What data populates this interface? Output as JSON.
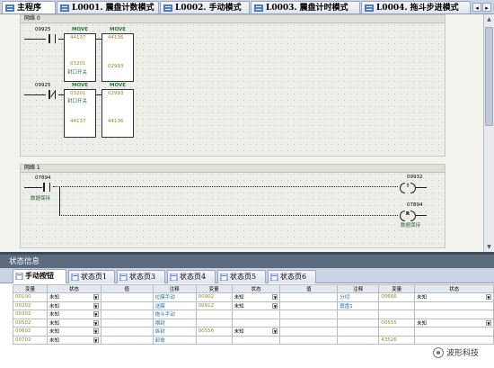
{
  "tabs": [
    {
      "label": "主程序",
      "active": true
    },
    {
      "label": "L0001. 震盘计数模式",
      "active": false
    },
    {
      "label": "L0002. 手动模式",
      "active": false
    },
    {
      "label": "L0003. 震盘计时模式",
      "active": false
    },
    {
      "label": "L0004. 拖斗步进模式",
      "active": false
    }
  ],
  "network0": {
    "title": "网络 0",
    "rung1": {
      "contact": "09925",
      "move1": {
        "title": "MOVE",
        "in": "44137",
        "out": "03201",
        "note": "封口开关"
      },
      "move2": {
        "title": "MOVE",
        "in": "44136",
        "out": "02993"
      }
    },
    "rung2": {
      "contact": "09925",
      "move1": {
        "title": "MOVE",
        "in": "03201",
        "note": "封口开关",
        "out": "44137"
      },
      "move2": {
        "title": "MOVE",
        "in": "02993",
        "out": "44136"
      }
    }
  },
  "network1": {
    "title": "网络 1",
    "contact": "07894",
    "contact_note": "数据保持",
    "coil1": {
      "addr": "09932",
      "symbol": "↑"
    },
    "coil2": {
      "addr": "07894",
      "symbol": "R",
      "note": "数据保持"
    }
  },
  "status": {
    "header": "状态信息",
    "tabs": [
      {
        "label": "手动按钮",
        "active": true
      },
      {
        "label": "状态页1"
      },
      {
        "label": "状态页3"
      },
      {
        "label": "状态页4"
      },
      {
        "label": "状态页5"
      },
      {
        "label": "状态页6"
      }
    ],
    "columns": [
      "变量",
      "状态",
      "值",
      "注释",
      "变量",
      "状态",
      "值",
      "注释",
      "变量",
      "状态"
    ],
    "rows": [
      [
        "00100",
        "未知",
        "",
        "拉膜手动",
        "00902",
        "未知",
        "",
        "分切",
        "00666",
        "未知"
      ],
      [
        "00202",
        "未知",
        "",
        "送膜",
        "00912",
        "未知",
        "",
        "震盘1",
        "",
        ""
      ],
      [
        "00302",
        "未知",
        "",
        "拖斗手动",
        "",
        "",
        "",
        "",
        "",
        ""
      ],
      [
        "00502",
        "未知",
        "",
        "横封",
        "",
        "",
        "",
        "",
        "00555",
        "未知"
      ],
      [
        "00602",
        "未知",
        "",
        "纵封",
        "00556",
        "未知",
        "",
        "",
        "",
        ""
      ],
      [
        "00702",
        "未知",
        "",
        "卸膏",
        "",
        "",
        "",
        "",
        "43526",
        ""
      ]
    ]
  },
  "watermark": "波形科技",
  "colors": {
    "tabbar": "#c9d3e3",
    "status_header": "#5d6b7f",
    "network_bg": "#ededea",
    "note_blue": "#1a6fb0",
    "var_olive": "#8a8a2a"
  }
}
